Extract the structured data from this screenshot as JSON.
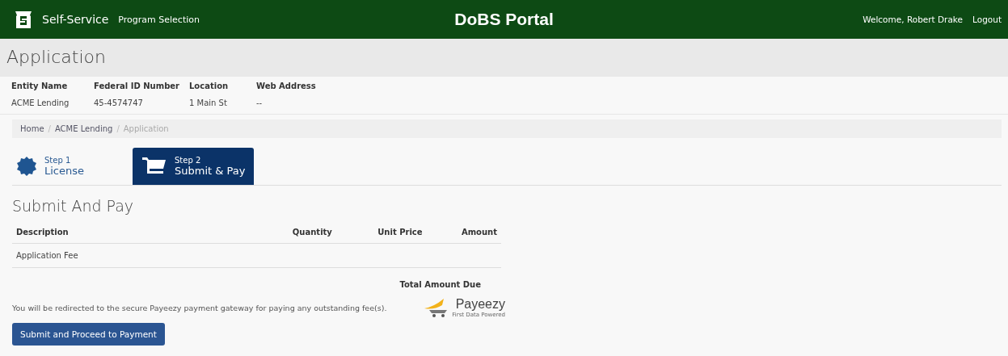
{
  "header": {
    "brand": "Self-Service",
    "nav": [
      "Program Selection"
    ],
    "title": "DoBS Portal",
    "welcome": "Welcome, Robert Drake",
    "logout": "Logout"
  },
  "page_title": "Application",
  "entity": {
    "columns": [
      "Entity Name",
      "Federal ID Number",
      "Location",
      "Web Address"
    ],
    "values": [
      "ACME Lending",
      "45-4574747",
      "1 Main St",
      "--"
    ]
  },
  "breadcrumb_separator": "/",
  "breadcrumb": [
    {
      "label": "Home",
      "current": false
    },
    {
      "label": "ACME Lending",
      "current": false
    },
    {
      "label": "Application",
      "current": true
    }
  ],
  "steps": [
    {
      "step": "Step 1",
      "label": "License",
      "selected": false,
      "kind": "badge"
    },
    {
      "step": "Step 2",
      "label": "Submit & Pay",
      "selected": true,
      "kind": "cart"
    }
  ],
  "section_title": "Submit And Pay",
  "table": {
    "columns": [
      "Description",
      "Quantity",
      "Unit Price",
      "Amount"
    ],
    "rows": [
      [
        "Application Fee"
      ]
    ],
    "total_label": "Total Amount Due"
  },
  "notice": "You will be redirected to the secure Payeezy payment gateway for paying any outstanding fee(s).",
  "payeezy": {
    "name": "Payeezy",
    "tagline": "First Data Powered"
  },
  "submit_button": "Submit and Proceed to Payment"
}
